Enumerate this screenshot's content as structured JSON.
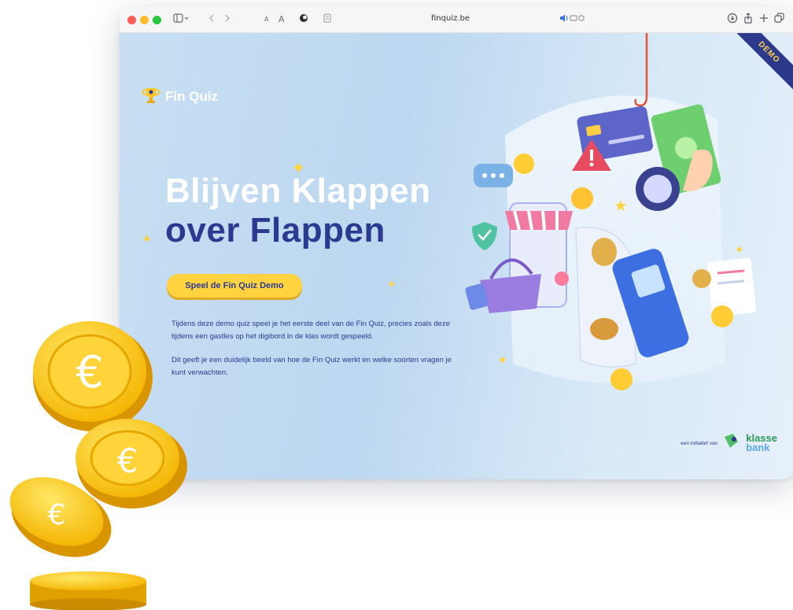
{
  "browser": {
    "url": "finquiz.be",
    "text_size_small": "A",
    "text_size_large": "A"
  },
  "page": {
    "demo_ribbon": "DEMO",
    "logo_text": "Fin Quiz",
    "headline_line1": "Blijven Klappen",
    "headline_line2": "over Flappen",
    "cta_label": "Speel de Fin Quiz Demo",
    "paragraph1": "Tijdens deze demo quiz speel je het eerste deel van de Fin Quiz, precies zoals deze tijdens een gastles op het digibord in de klas wordt gespeeld.",
    "paragraph2": "Dit geeft je een duidelijk beeld van hoe de Fin Quiz werkt en welke soorten vragen je kunt verwachten.",
    "initiative_text": "een initiatief van",
    "brand_line1": "klasse",
    "brand_line2": "bank"
  },
  "colors": {
    "accent_yellow": "#ffd23f",
    "navy": "#2b3a8f",
    "brand_green": "#2e9b57",
    "page_blue": "#c8dff3"
  },
  "icons": {
    "coin_symbol": "€"
  }
}
